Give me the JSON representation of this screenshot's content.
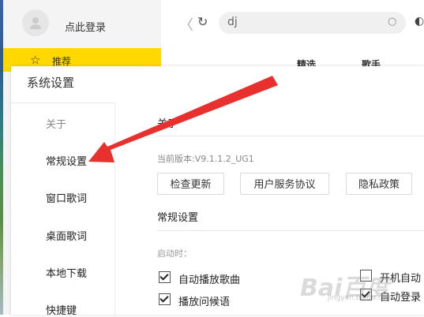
{
  "app": {
    "login_text": "点此登录",
    "recommend_label": "推荐",
    "search_value": "dj",
    "tabs": [
      "精选",
      "歌手"
    ]
  },
  "dialog": {
    "title": "系统设置",
    "nav": [
      "关于",
      "常规设置",
      "窗口歌词",
      "桌面歌词",
      "本地下载",
      "快捷键"
    ],
    "active_nav": "关于",
    "about_heading": "关于",
    "version": "当前版本:V9.1.1.2_UG1",
    "buttons": [
      "检查更新",
      "用户服务协议",
      "隐私政策"
    ],
    "general_heading": "常规设置",
    "startup_label": "启动时：",
    "options": [
      {
        "label": "自动播放歌曲",
        "checked": true
      },
      {
        "label": "播放问候语",
        "checked": true
      },
      {
        "label": "开机自动",
        "checked": false
      },
      {
        "label": "自动登录",
        "checked": true
      }
    ]
  },
  "watermark": {
    "text": "Bai百度",
    "sub": "jingyan.baidu.com"
  },
  "colors": {
    "accent": "#ffd800",
    "arrow": "#e8302f"
  }
}
